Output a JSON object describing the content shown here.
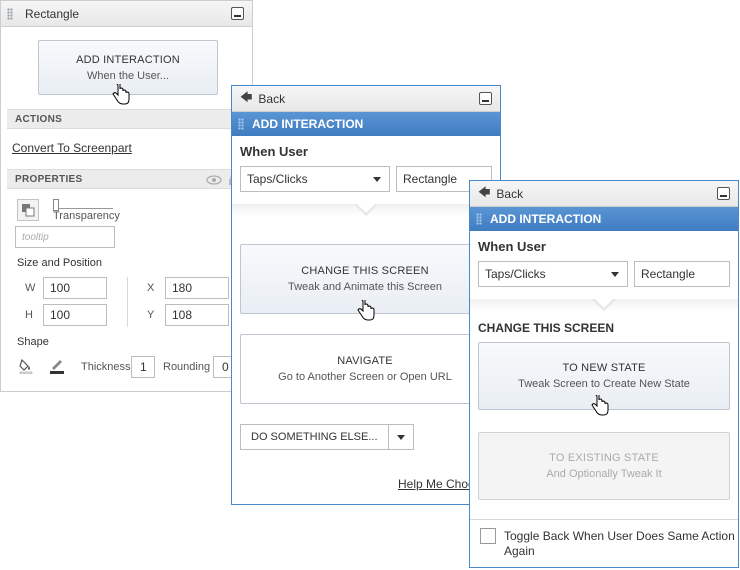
{
  "props_panel": {
    "title": "Rectangle",
    "add_interaction": {
      "line1": "ADD INTERACTION",
      "line2": "When the User..."
    },
    "actions_header": "ACTIONS",
    "convert_link": "Convert To Screenpart",
    "properties_header": "PROPERTIES",
    "transparency_label": "Transparency",
    "tooltip_placeholder": "tooltip",
    "size_position_header": "Size and Position",
    "w_label": "W",
    "w_value": "100",
    "x_label": "X",
    "x_value": "180",
    "h_label": "H",
    "h_value": "100",
    "y_label": "Y",
    "y_value": "108",
    "shape_header": "Shape",
    "thickness_label": "Thickness",
    "thickness_value": "1",
    "rounding_label": "Rounding",
    "rounding_value": "0"
  },
  "interaction_panel": {
    "back_label": "Back",
    "header": "ADD INTERACTION",
    "when_user_label": "When User",
    "event_select": "Taps/Clicks",
    "target_value": "Rectangle",
    "change_screen": {
      "line1": "CHANGE THIS SCREEN",
      "line2": "Tweak and Animate this Screen"
    },
    "navigate": {
      "line1": "NAVIGATE",
      "line2": "Go to Another Screen or Open URL"
    },
    "do_something": "DO SOMETHING ELSE...",
    "help_link": "Help Me Choo"
  },
  "change_panel": {
    "back_label": "Back",
    "header": "ADD INTERACTION",
    "when_user_label": "When User",
    "event_select": "Taps/Clicks",
    "target_value": "Rectangle",
    "section_title": "CHANGE THIS SCREEN",
    "new_state": {
      "line1": "TO NEW STATE",
      "line2": "Tweak Screen to Create New State"
    },
    "existing_state": {
      "line1": "TO EXISTING STATE",
      "line2": "And Optionally Tweak It"
    },
    "toggle_back_label_1": "Toggle Back When User Does Same Action",
    "toggle_back_label_2": "Again"
  },
  "colors": {
    "accent": "#4a88cc",
    "border": "#c9ced3",
    "section_bg": "#ececec"
  }
}
